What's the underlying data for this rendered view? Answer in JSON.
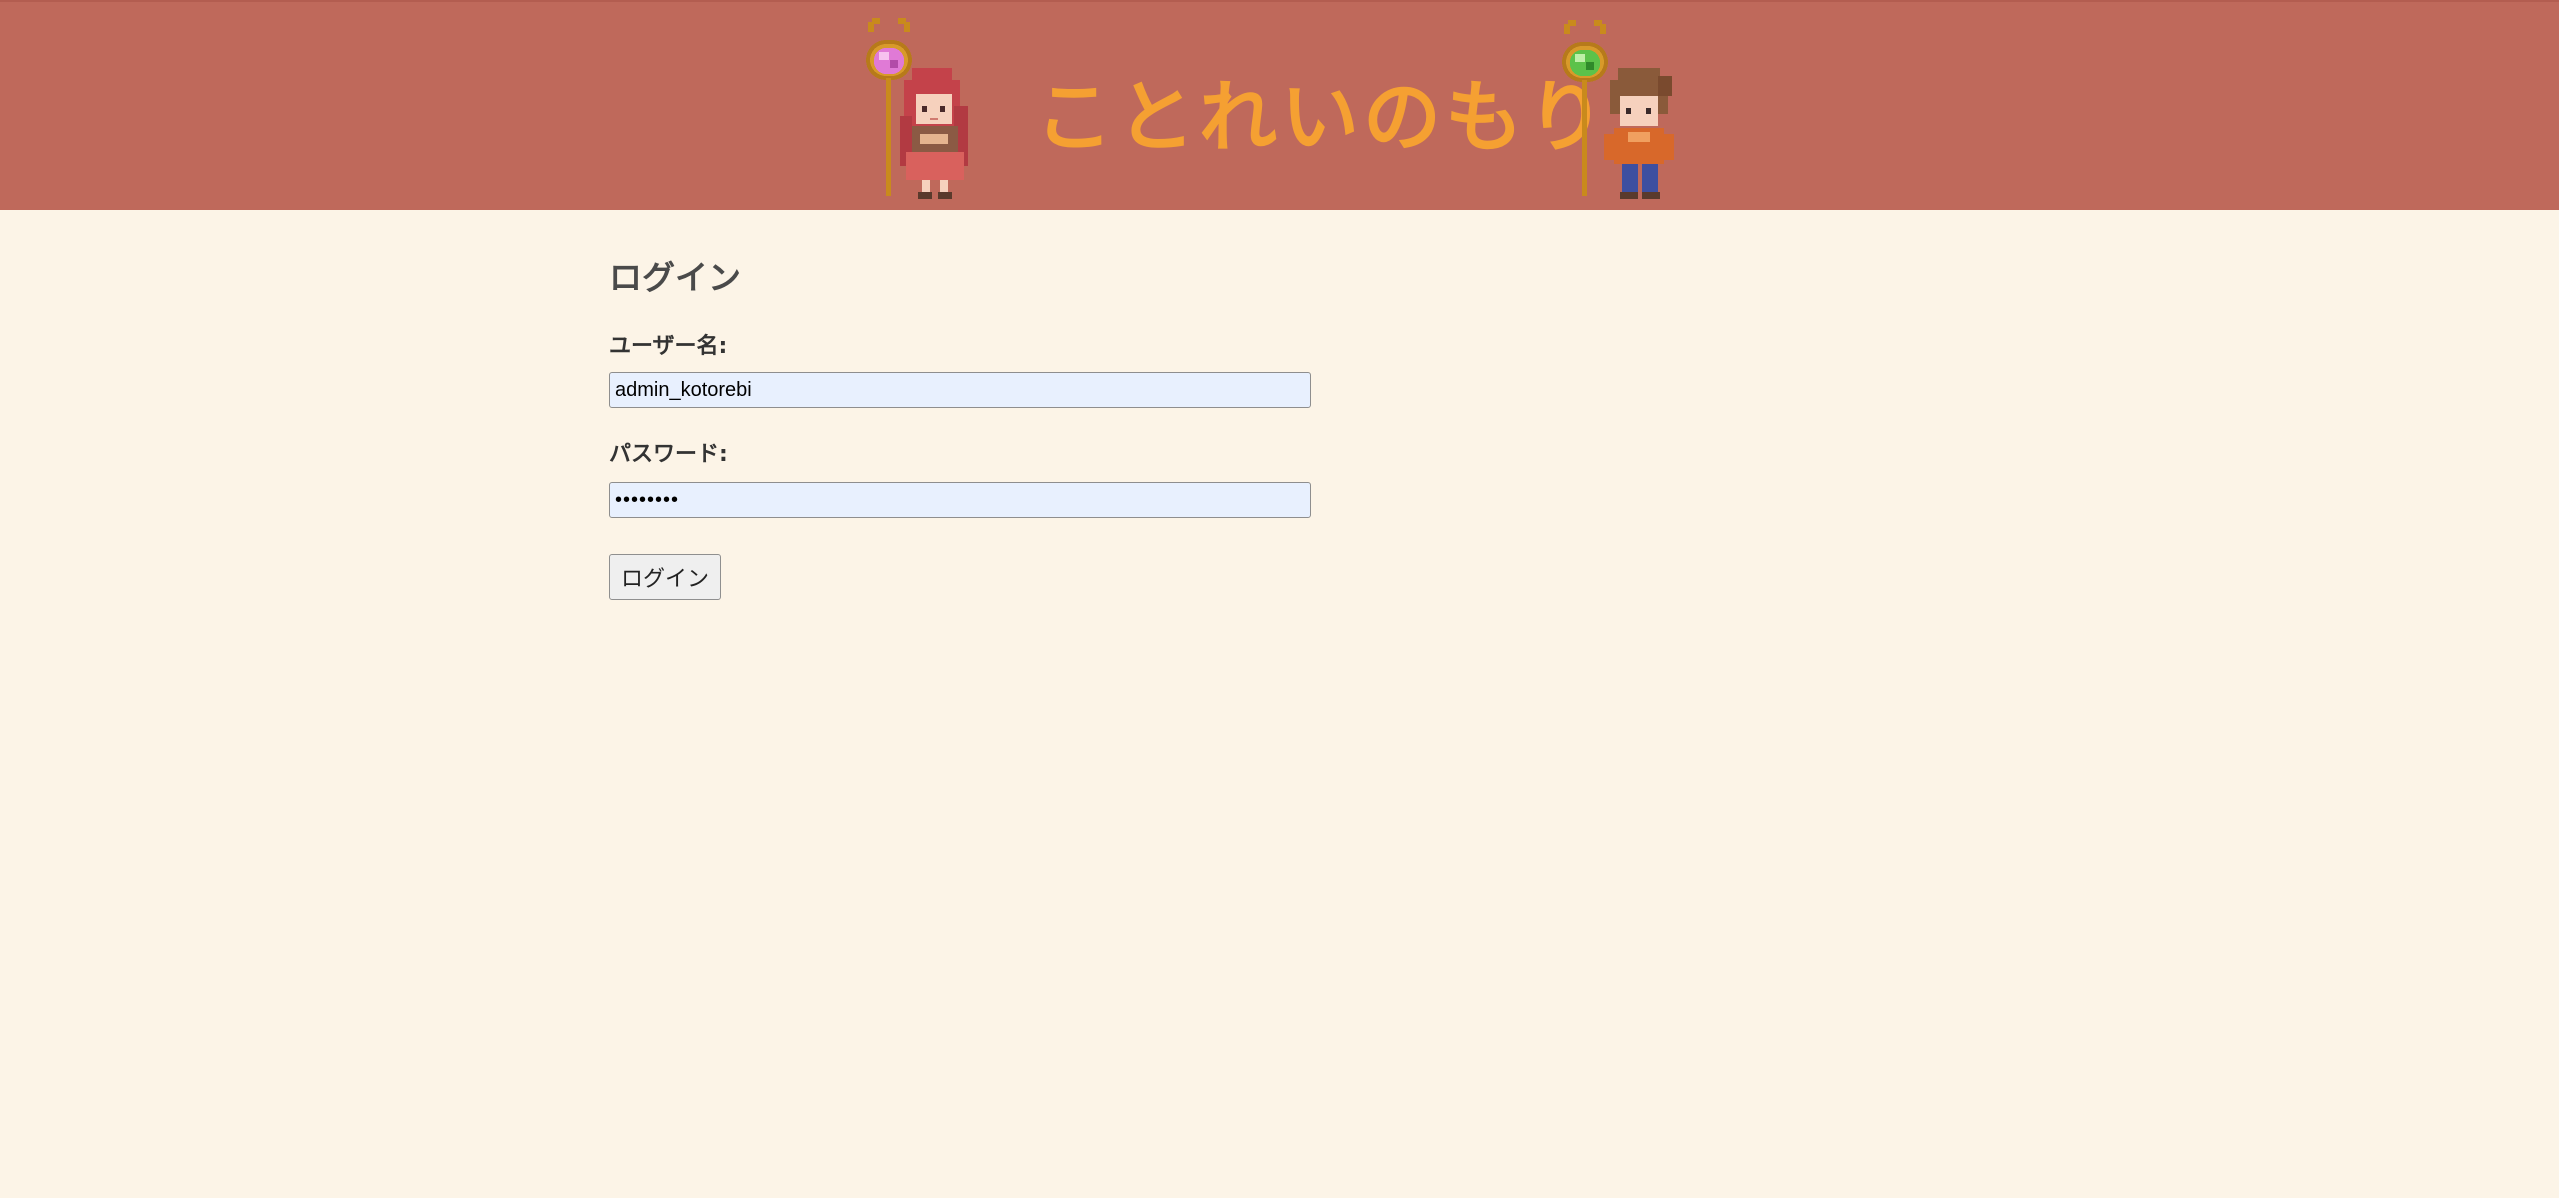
{
  "header": {
    "site_title": "ことれいのもり",
    "colors": {
      "background": "#bf695b",
      "title": "#f5a032"
    }
  },
  "login": {
    "heading": "ログイン",
    "username_label": "ユーザー名:",
    "username_value": "admin_kotorebi",
    "password_label": "パスワード:",
    "password_value": "kotorebi",
    "submit_label": "ログイン"
  },
  "colors": {
    "page_background": "#fcf4e7",
    "input_background": "#e8f0fe"
  },
  "icons": {
    "left_character": "mage-girl-pink-orb-icon",
    "right_character": "mage-boy-green-orb-icon"
  }
}
